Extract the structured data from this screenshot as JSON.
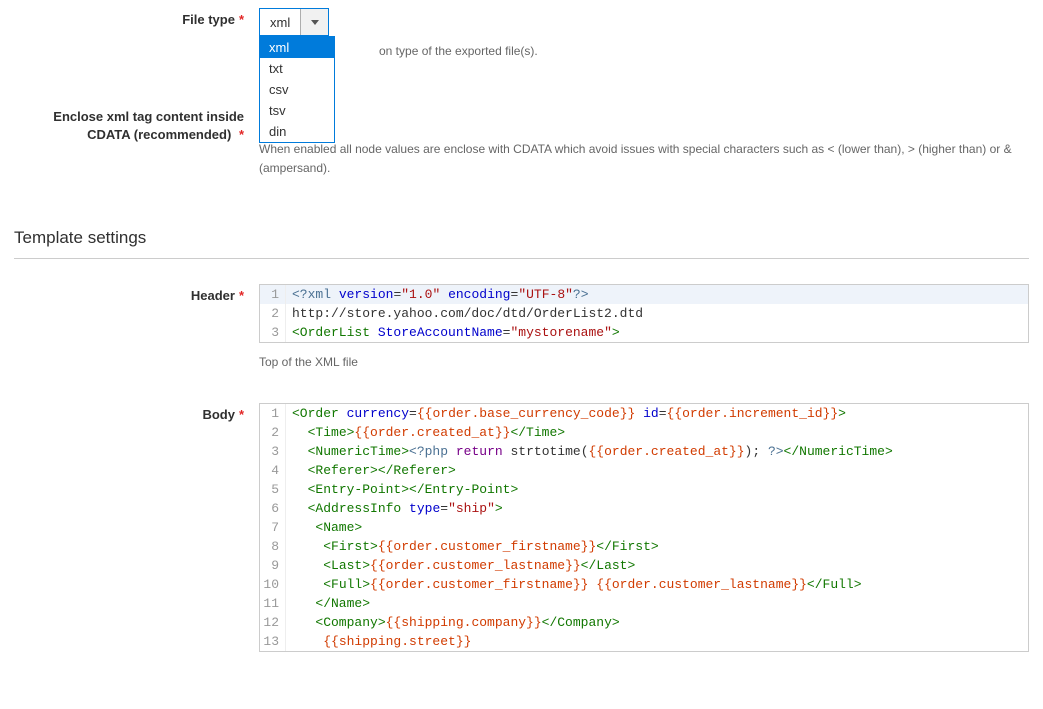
{
  "file_type": {
    "label": "File type",
    "selected": "xml",
    "options": [
      "xml",
      "txt",
      "csv",
      "tsv",
      "din"
    ],
    "help_suffix": "on type of the exported file(s)."
  },
  "enclose_cdata": {
    "label1": "Enclose xml tag content inside",
    "label2": "CDATA (recommended)",
    "help": "When enabled all node values are enclose with CDATA which avoid issues with special characters such as < (lower than), > (higher than) or & (ampersand)."
  },
  "template_section": {
    "title": "Template settings"
  },
  "header": {
    "label": "Header",
    "note": "Top of the XML file",
    "lines": [
      {
        "n": "1",
        "tokens": [
          [
            "decl",
            "<?xml"
          ],
          [
            "txt",
            " "
          ],
          [
            "attr",
            "version"
          ],
          [
            "txt",
            "="
          ],
          [
            "str",
            "\"1.0\""
          ],
          [
            "txt",
            " "
          ],
          [
            "attr",
            "encoding"
          ],
          [
            "txt",
            "="
          ],
          [
            "str",
            "\"UTF-8\""
          ],
          [
            "decl",
            "?>"
          ]
        ]
      },
      {
        "n": "2",
        "tokens": [
          [
            "link",
            "http://store.yahoo.com/doc/dtd/OrderList2.dtd"
          ]
        ]
      },
      {
        "n": "3",
        "tokens": [
          [
            "tag",
            "<OrderList"
          ],
          [
            "txt",
            " "
          ],
          [
            "attr",
            "StoreAccountName"
          ],
          [
            "txt",
            "="
          ],
          [
            "str",
            "\"mystorename\""
          ],
          [
            "tag",
            ">"
          ]
        ]
      }
    ]
  },
  "body": {
    "label": "Body",
    "lines": [
      {
        "n": "1",
        "tokens": [
          [
            "tag",
            "<Order"
          ],
          [
            "txt",
            " "
          ],
          [
            "attr",
            "currency"
          ],
          [
            "txt",
            "="
          ],
          [
            "var",
            "{{order.base_currency_code}}"
          ],
          [
            "txt",
            " "
          ],
          [
            "attr",
            "id"
          ],
          [
            "txt",
            "="
          ],
          [
            "var",
            "{{order.increment_id}}"
          ],
          [
            "tag",
            ">"
          ]
        ]
      },
      {
        "n": "2",
        "tokens": [
          [
            "txt",
            "  "
          ],
          [
            "tag",
            "<Time>"
          ],
          [
            "var",
            "{{order.created_at}}"
          ],
          [
            "tag",
            "</Time>"
          ]
        ]
      },
      {
        "n": "3",
        "tokens": [
          [
            "txt",
            "  "
          ],
          [
            "tag",
            "<NumericTime>"
          ],
          [
            "decl",
            "<?php"
          ],
          [
            "txt",
            " "
          ],
          [
            "kw",
            "return"
          ],
          [
            "txt",
            " "
          ],
          [
            "txt",
            "strtotime("
          ],
          [
            "var",
            "{{order.created_at}}"
          ],
          [
            "txt",
            "); "
          ],
          [
            "decl",
            "?>"
          ],
          [
            "tag",
            "</NumericTime>"
          ]
        ]
      },
      {
        "n": "4",
        "tokens": [
          [
            "txt",
            "  "
          ],
          [
            "tag",
            "<Referer>"
          ],
          [
            "tag",
            "</Referer>"
          ]
        ]
      },
      {
        "n": "5",
        "tokens": [
          [
            "txt",
            "  "
          ],
          [
            "tag",
            "<Entry-Point>"
          ],
          [
            "tag",
            "</Entry-Point>"
          ]
        ]
      },
      {
        "n": "6",
        "tokens": [
          [
            "txt",
            "  "
          ],
          [
            "tag",
            "<AddressInfo"
          ],
          [
            "txt",
            " "
          ],
          [
            "attr",
            "type"
          ],
          [
            "txt",
            "="
          ],
          [
            "str",
            "\"ship\""
          ],
          [
            "tag",
            ">"
          ]
        ]
      },
      {
        "n": "7",
        "tokens": [
          [
            "txt",
            "   "
          ],
          [
            "tag",
            "<Name>"
          ]
        ]
      },
      {
        "n": "8",
        "tokens": [
          [
            "txt",
            "    "
          ],
          [
            "tag",
            "<First>"
          ],
          [
            "var",
            "{{order.customer_firstname}}"
          ],
          [
            "tag",
            "</First>"
          ]
        ]
      },
      {
        "n": "9",
        "tokens": [
          [
            "txt",
            "    "
          ],
          [
            "tag",
            "<Last>"
          ],
          [
            "var",
            "{{order.customer_lastname}}"
          ],
          [
            "tag",
            "</Last>"
          ]
        ]
      },
      {
        "n": "10",
        "tokens": [
          [
            "txt",
            "    "
          ],
          [
            "tag",
            "<Full>"
          ],
          [
            "var",
            "{{order.customer_firstname}}"
          ],
          [
            "txt",
            " "
          ],
          [
            "var",
            "{{order.customer_lastname}}"
          ],
          [
            "tag",
            "</Full>"
          ]
        ]
      },
      {
        "n": "11",
        "tokens": [
          [
            "txt",
            "   "
          ],
          [
            "tag",
            "</Name>"
          ]
        ]
      },
      {
        "n": "12",
        "tokens": [
          [
            "txt",
            "   "
          ],
          [
            "tag",
            "<Company>"
          ],
          [
            "var",
            "{{shipping.company}}"
          ],
          [
            "tag",
            "</Company>"
          ]
        ]
      },
      {
        "n": "13",
        "tokens": [
          [
            "txt",
            "    "
          ],
          [
            "var",
            "{{shipping.street}}"
          ]
        ]
      }
    ]
  }
}
